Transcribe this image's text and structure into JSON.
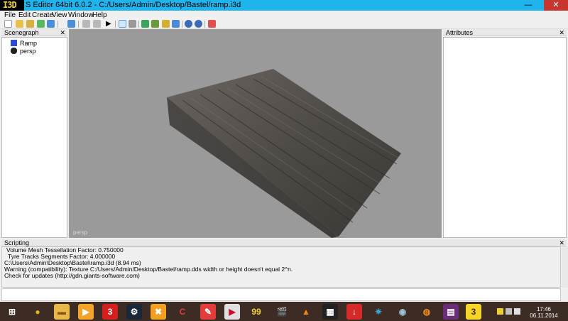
{
  "window": {
    "logo": "I3D",
    "title": "S Editor 64bit 6.0.2 - C:/Users/Admin/Desktop/Bastel/ramp.i3d",
    "min_glyph": "—",
    "max_glyph": "□",
    "close_glyph": "✕"
  },
  "menu": [
    "File",
    "Edit",
    "Create",
    "View",
    "Window",
    "Help"
  ],
  "toolbar_icons": [
    "new-file-icon",
    "open-folder-icon",
    "save-icon",
    "export-icon",
    "import-icon",
    "undo-icon",
    "redo-icon",
    "play-icon",
    "select-tool-icon",
    "move-tool-icon",
    "terrain-paint-icon",
    "terrain-sculpt-icon",
    "foliage-paint-icon",
    "terrain-height-icon",
    "settings-icon",
    "render-settings-icon",
    "delete-icon"
  ],
  "scenegraph": {
    "title": "Scenegraph",
    "close": "✕",
    "items": [
      "Ramp",
      "persp"
    ]
  },
  "viewport": {
    "label": "persp"
  },
  "attributes": {
    "title": "Attributes",
    "close": "✕"
  },
  "scripting": {
    "title": "Scripting",
    "close": "✕",
    "lines": [
      "Volume Mesh Tessellation Factor: 0.750000",
      "Tyre Tracks Segments Factor: 4.000000",
      "C:\\Users\\Admin\\Desktop\\Bastel\\ramp.i3d (8.94 ms)",
      "Warning (compatibility): Texture C:/Users/Admin/Desktop/Bastel/ramp.dds width or height doesn't equal 2^n.",
      "Check for updates (http://gdn.giants-software.com)"
    ]
  },
  "taskbar": {
    "apps": [
      {
        "name": "windows-start-icon",
        "glyph": "⊞",
        "color": "#3d2c24",
        "fg": "#ffffff"
      },
      {
        "name": "chrome-icon",
        "glyph": "●",
        "color": "#3d2c24",
        "fg": "#e8b21f"
      },
      {
        "name": "file-explorer-icon",
        "glyph": "▬",
        "color": "#e8b84a",
        "fg": "#8a5a10"
      },
      {
        "name": "media-player-icon",
        "glyph": "▶",
        "color": "#f4a428",
        "fg": "#ffffff"
      },
      {
        "name": "app-3-icon",
        "glyph": "3",
        "color": "#d3201f",
        "fg": "#ffffff"
      },
      {
        "name": "steam-icon",
        "glyph": "⚙",
        "color": "#1b2838",
        "fg": "#ffffff"
      },
      {
        "name": "tools-icon",
        "glyph": "✖",
        "color": "#f3a020",
        "fg": "#ffffff"
      },
      {
        "name": "ccleaner-icon",
        "glyph": "C",
        "color": "#3d2c24",
        "fg": "#e43b3b"
      },
      {
        "name": "notes-icon",
        "glyph": "✎",
        "color": "#e23c3c",
        "fg": "#ffffff"
      },
      {
        "name": "video-player-icon",
        "glyph": "▶",
        "color": "#e0e0e0",
        "fg": "#c8102e"
      },
      {
        "name": "counter-icon",
        "glyph": "99",
        "color": "#3d2c24",
        "fg": "#f0d030"
      },
      {
        "name": "clapper-icon",
        "glyph": "🎬",
        "color": "#3d2c24",
        "fg": "#ffffff"
      },
      {
        "name": "vlc-icon",
        "glyph": "▲",
        "color": "#3d2c24",
        "fg": "#ff8800"
      },
      {
        "name": "film-icon",
        "glyph": "▦",
        "color": "#222222",
        "fg": "#ffffff"
      },
      {
        "name": "download-icon",
        "glyph": "↓",
        "color": "#d62a2a",
        "fg": "#ffffff"
      },
      {
        "name": "gear-app-icon",
        "glyph": "✷",
        "color": "#3d2c24",
        "fg": "#3aa3d8"
      },
      {
        "name": "disk-icon",
        "glyph": "◉",
        "color": "#3d2c24",
        "fg": "#9fc3d8"
      },
      {
        "name": "blender-icon",
        "glyph": "◍",
        "color": "#3d2c24",
        "fg": "#f08a1a"
      },
      {
        "name": "winrar-icon",
        "glyph": "▤",
        "color": "#6b2d7a",
        "fg": "#ffffff"
      },
      {
        "name": "giants-editor-icon",
        "glyph": "3",
        "color": "#f6d428",
        "fg": "#3d2c24"
      }
    ],
    "clock_time": "17:46",
    "clock_date": "06.11.2014"
  }
}
